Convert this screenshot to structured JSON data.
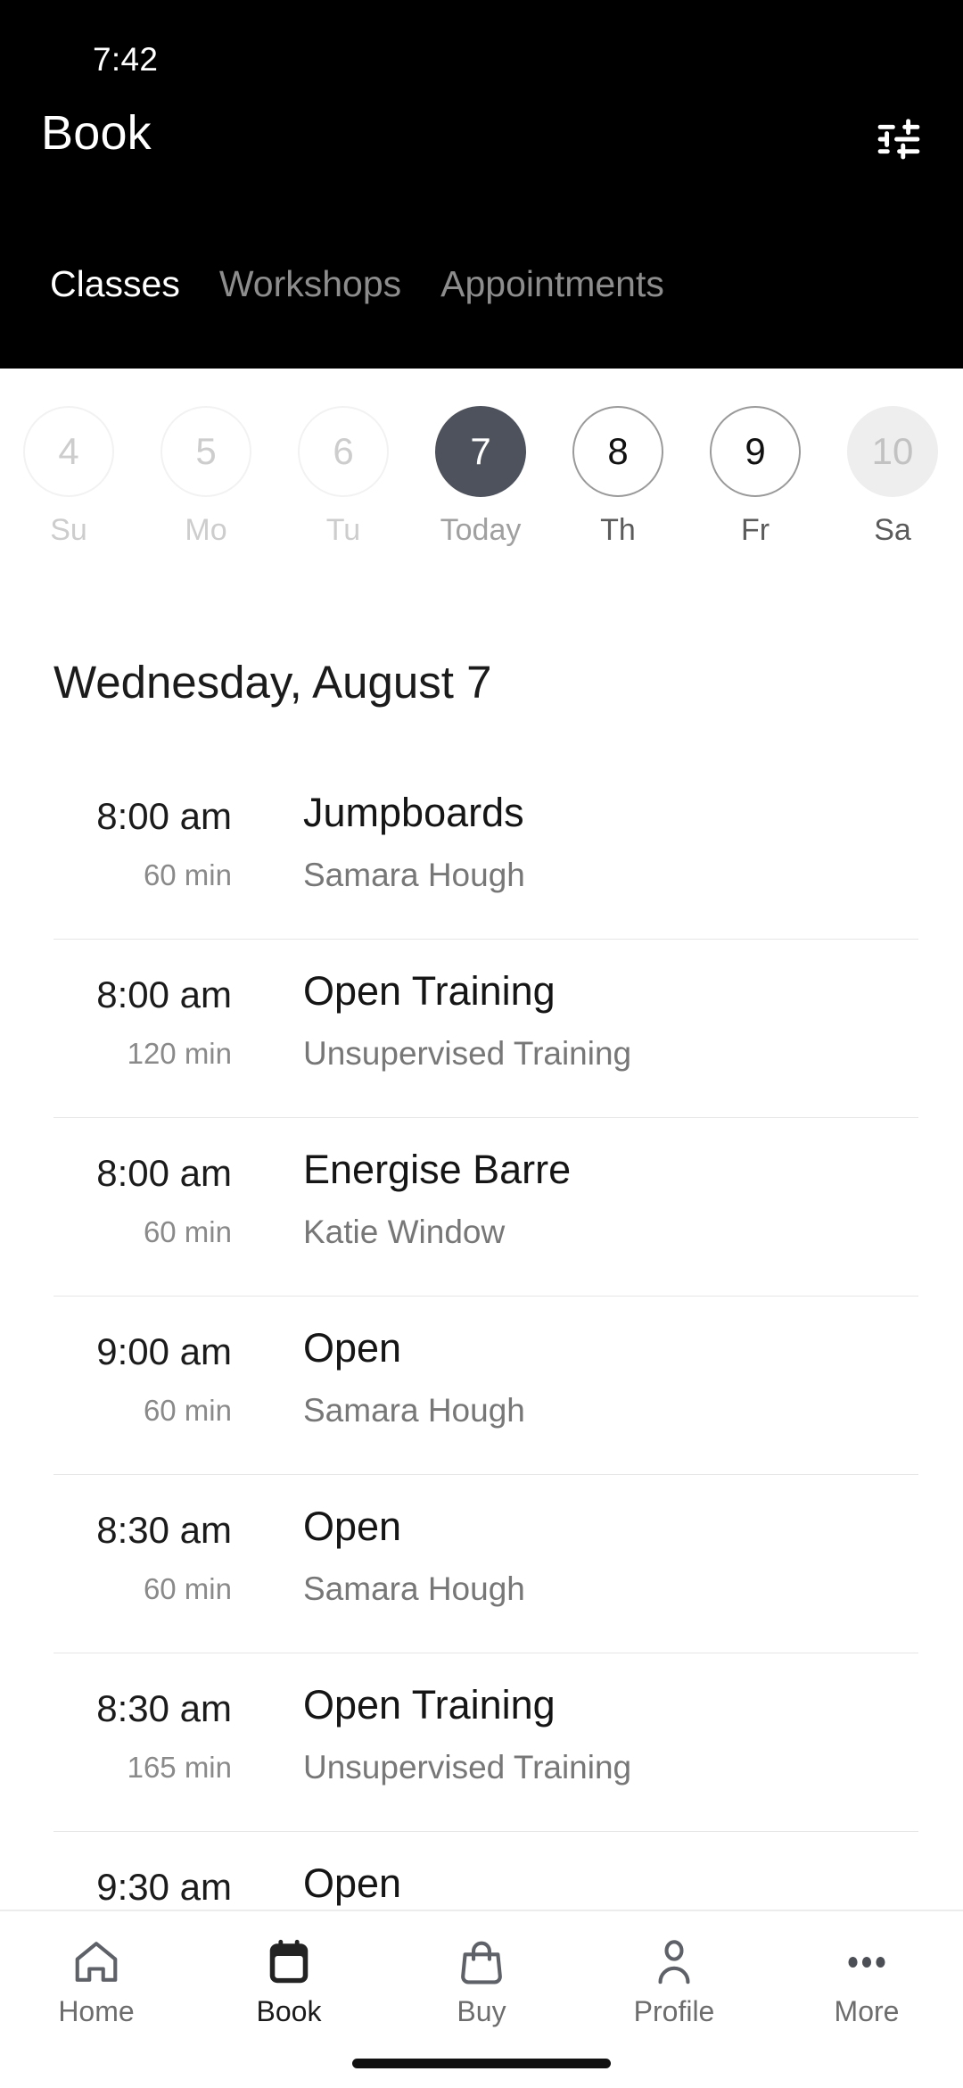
{
  "status_bar": {
    "time": "7:42"
  },
  "header": {
    "title": "Book",
    "filter_icon": "tune-filter-icon",
    "tabs": [
      {
        "label": "Classes",
        "active": true
      },
      {
        "label": "Workshops",
        "active": false
      },
      {
        "label": "Appointments",
        "active": false
      }
    ]
  },
  "date_strip": {
    "days": [
      {
        "num": "4",
        "label": "Su",
        "state": "disabled"
      },
      {
        "num": "5",
        "label": "Mo",
        "state": "disabled"
      },
      {
        "num": "6",
        "label": "Tu",
        "state": "disabled"
      },
      {
        "num": "7",
        "label": "Today",
        "state": "selected"
      },
      {
        "num": "8",
        "label": "Th",
        "state": "normal"
      },
      {
        "num": "9",
        "label": "Fr",
        "state": "normal"
      },
      {
        "num": "10",
        "label": "Sa",
        "state": "tinted"
      }
    ]
  },
  "day_heading": "Wednesday, August 7",
  "schedule": {
    "rows": [
      {
        "time": "8:00 am",
        "duration": "60 min",
        "name": "Jumpboards",
        "instructor": "Samara Hough"
      },
      {
        "time": "8:00 am",
        "duration": "120 min",
        "name": "Open Training",
        "instructor": "Unsupervised Training"
      },
      {
        "time": "8:00 am",
        "duration": "60 min",
        "name": "Energise Barre",
        "instructor": "Katie Window"
      },
      {
        "time": "9:00 am",
        "duration": "60 min",
        "name": "Open",
        "instructor": "Samara Hough"
      },
      {
        "time": "8:30 am",
        "duration": "60 min",
        "name": "Open",
        "instructor": "Samara Hough"
      },
      {
        "time": "8:30 am",
        "duration": "165 min",
        "name": "Open Training",
        "instructor": "Unsupervised Training"
      },
      {
        "time": "9:30 am",
        "duration": "",
        "name": "Open",
        "instructor": ""
      }
    ]
  },
  "bottom_nav": {
    "items": [
      {
        "label": "Home",
        "icon": "home-icon",
        "active": false
      },
      {
        "label": "Book",
        "icon": "calendar-icon",
        "active": true
      },
      {
        "label": "Buy",
        "icon": "shopping-bag-icon",
        "active": false
      },
      {
        "label": "Profile",
        "icon": "person-icon",
        "active": false
      },
      {
        "label": "More",
        "icon": "more-dots-icon",
        "active": false
      }
    ]
  },
  "colors": {
    "header_bg": "#000000",
    "selected_day": "#4e525c",
    "divider": "#e6e6e6",
    "muted_text": "#8a8a8a"
  }
}
